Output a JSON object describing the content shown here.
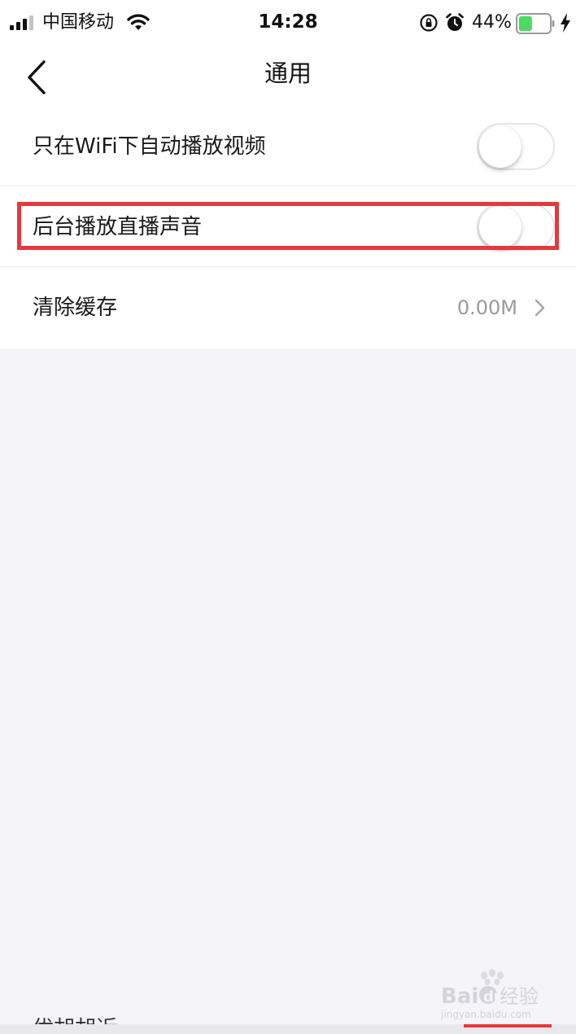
{
  "status_bar": {
    "carrier": "中国移动",
    "time": "14:28",
    "battery_percent": "44%",
    "battery_level": 0.44,
    "battery_color": "#4cd964",
    "icons": [
      "signal-icon",
      "wifi-icon",
      "rotation-lock-icon",
      "alarm-icon",
      "battery-icon",
      "charging-bolt-icon"
    ]
  },
  "nav": {
    "title": "通用",
    "back_icon": "chevron-left-icon"
  },
  "settings": {
    "rows": [
      {
        "label": "只在WiFi下自动播放视频",
        "type": "toggle",
        "enabled": false
      },
      {
        "label": "后台播放直播声音",
        "type": "toggle",
        "enabled": false,
        "highlighted": true
      },
      {
        "label": "清除缓存",
        "type": "detail",
        "value": "0.00M",
        "icon": "chevron-right-icon"
      }
    ]
  },
  "colors": {
    "highlight": "#e8373a",
    "background": "#f4f4f9",
    "secondary_text": "#9a9aa2"
  },
  "watermark": {
    "brand": "Baidu经验",
    "url": "jingyan.baidu.com"
  },
  "bottom": {
    "cut_off_text": "优胡胡近"
  }
}
